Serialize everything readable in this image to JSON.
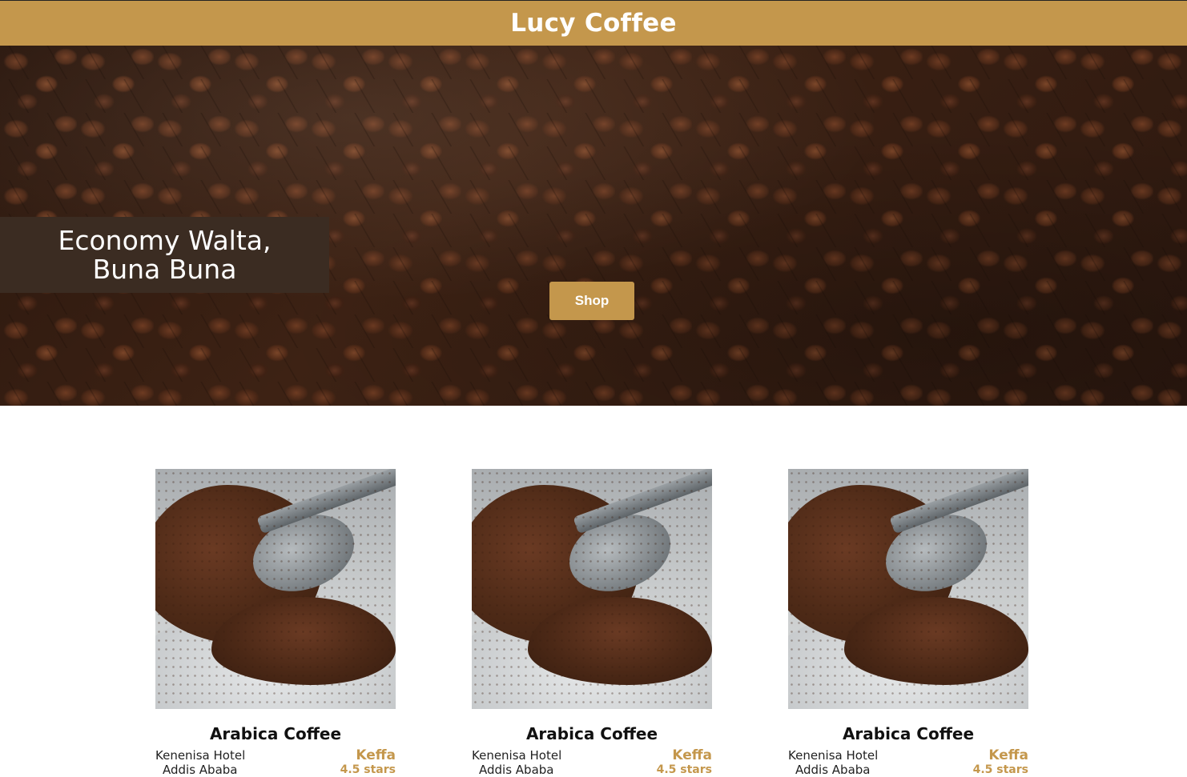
{
  "header": {
    "title": "Lucy Coffee"
  },
  "hero": {
    "tagline_line1": "Economy Walta,",
    "tagline_line2": "Buna Buna",
    "shop_label": "Shop"
  },
  "products": [
    {
      "name": "Arabica Coffee",
      "venue": "Kenenisa Hotel",
      "city": "Addis Ababa",
      "origin": "Keffa",
      "rating": "4.5 stars"
    },
    {
      "name": "Arabica Coffee",
      "venue": "Kenenisa Hotel",
      "city": "Addis Ababa",
      "origin": "Keffa",
      "rating": "4.5 stars"
    },
    {
      "name": "Arabica Coffee",
      "venue": "Kenenisa Hotel",
      "city": "Addis Ababa",
      "origin": "Keffa",
      "rating": "4.5 stars"
    }
  ],
  "colors": {
    "brand": "#c4974c",
    "tagline_bg": "#3b2c22"
  }
}
